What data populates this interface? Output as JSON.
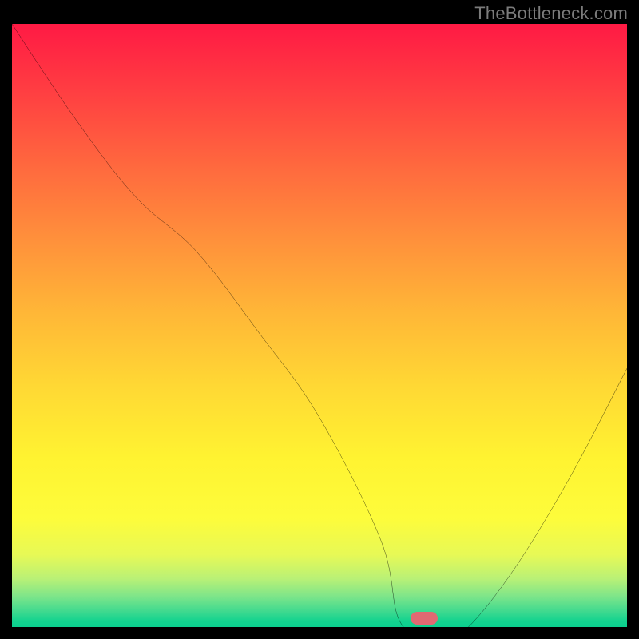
{
  "watermark": "TheBottleneck.com",
  "chart_data": {
    "type": "line",
    "title": "",
    "xlabel": "",
    "ylabel": "",
    "xlim": [
      0,
      100
    ],
    "ylim": [
      0,
      100
    ],
    "series": [
      {
        "name": "curve",
        "x": [
          0,
          10,
          20,
          30,
          40,
          50,
          60,
          63,
          68,
          72,
          80,
          90,
          100
        ],
        "y": [
          100,
          85,
          72,
          63,
          50,
          36,
          16,
          3,
          0,
          0,
          9,
          25,
          44
        ]
      }
    ],
    "marker": {
      "x": 67,
      "y": 1.5
    },
    "gradient_stops": [
      {
        "pos": 0.0,
        "color": "#ff1a44"
      },
      {
        "pos": 0.5,
        "color": "#ffc036"
      },
      {
        "pos": 0.8,
        "color": "#fffb33"
      },
      {
        "pos": 1.0,
        "color": "#0bd08f"
      }
    ]
  }
}
